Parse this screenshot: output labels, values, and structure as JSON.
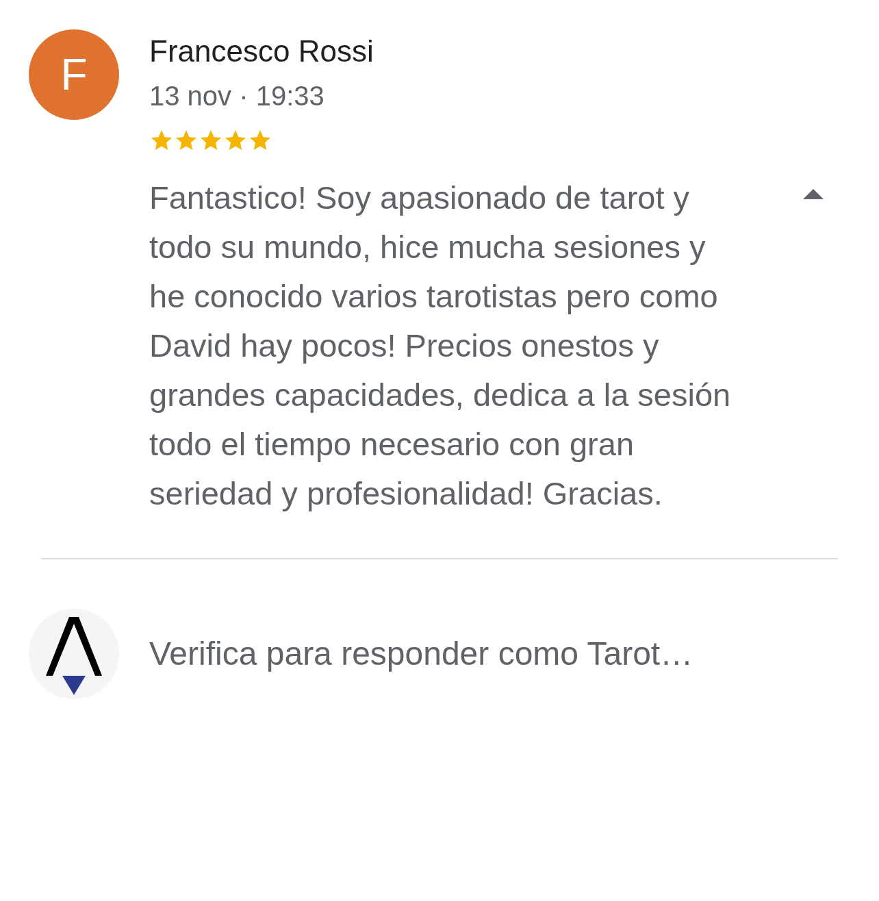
{
  "review": {
    "avatar_letter": "F",
    "author": "Francesco Rossi",
    "date": "13 nov · 19:33",
    "stars": 5,
    "text": "Fantastico! Soy apasionado de tarot y todo su mundo, hice mucha sesiones y he conocido varios tarotistas pero como David hay pocos! Precios onestos y grandes capacidades, dedica a la sesión todo el tiempo necesario con gran seriedad y profesionalidad! Gracias.",
    "expanded": true
  },
  "reply": {
    "placeholder": "Verifica para responder como Tarot…"
  }
}
